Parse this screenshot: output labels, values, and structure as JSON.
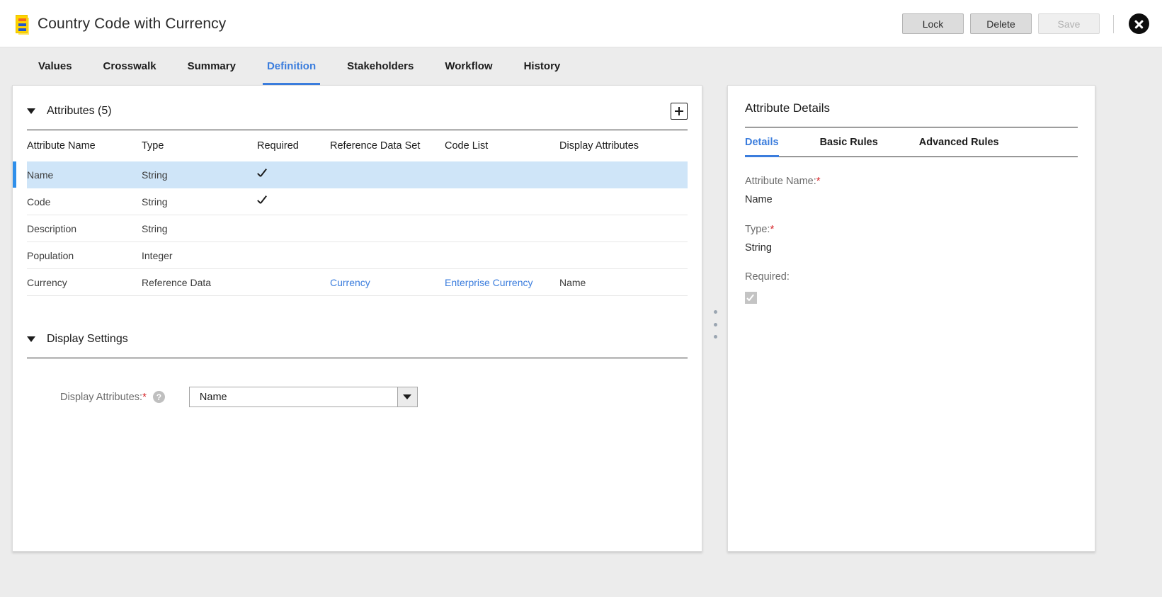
{
  "header": {
    "title": "Country Code with Currency",
    "icon": "reference-data-icon",
    "actions": {
      "lock_label": "Lock",
      "delete_label": "Delete",
      "save_label": "Save",
      "close_label": "close-icon"
    }
  },
  "tabs": [
    {
      "label": "Values",
      "active": false
    },
    {
      "label": "Crosswalk",
      "active": false
    },
    {
      "label": "Summary",
      "active": false
    },
    {
      "label": "Definition",
      "active": true
    },
    {
      "label": "Stakeholders",
      "active": false
    },
    {
      "label": "Workflow",
      "active": false
    },
    {
      "label": "History",
      "active": false
    }
  ],
  "attributes_section": {
    "title": "Attributes (5)",
    "add_button_label": "+",
    "columns": [
      "Attribute Name",
      "Type",
      "Required",
      "Reference Data Set",
      "Code List",
      "Display Attributes"
    ],
    "rows": [
      {
        "name": "Name",
        "type": "String",
        "required": true,
        "reference_data_set": "",
        "code_list": "",
        "display_attributes": "",
        "selected": true
      },
      {
        "name": "Code",
        "type": "String",
        "required": true,
        "reference_data_set": "",
        "code_list": "",
        "display_attributes": "",
        "selected": false
      },
      {
        "name": "Description",
        "type": "String",
        "required": false,
        "reference_data_set": "",
        "code_list": "",
        "display_attributes": "",
        "selected": false
      },
      {
        "name": "Population",
        "type": "Integer",
        "required": false,
        "reference_data_set": "",
        "code_list": "",
        "display_attributes": "",
        "selected": false
      },
      {
        "name": "Currency",
        "type": "Reference Data",
        "required": false,
        "reference_data_set": "Currency",
        "code_list": "Enterprise Currency",
        "display_attributes": "Name",
        "selected": false
      }
    ]
  },
  "display_settings": {
    "title": "Display Settings",
    "field_label": "Display Attributes:",
    "required_marker": "*",
    "help_icon_label": "?",
    "selected_value": "Name"
  },
  "attribute_details": {
    "title": "Attribute Details",
    "tabs": [
      {
        "label": "Details",
        "active": true
      },
      {
        "label": "Basic Rules",
        "active": false
      },
      {
        "label": "Advanced Rules",
        "active": false
      }
    ],
    "fields": {
      "attribute_name_label": "Attribute Name:",
      "attribute_name_value": "Name",
      "type_label": "Type:",
      "type_value": "String",
      "required_label": "Required:",
      "required_checked": true
    }
  },
  "colors": {
    "accent": "#3b7ddd",
    "selected_row_bg": "#cfe5f8",
    "selected_row_bar": "#2f8fea",
    "required_star": "#d6272b",
    "page_bg": "#ececec",
    "icon_yellow": "#ffd400"
  }
}
